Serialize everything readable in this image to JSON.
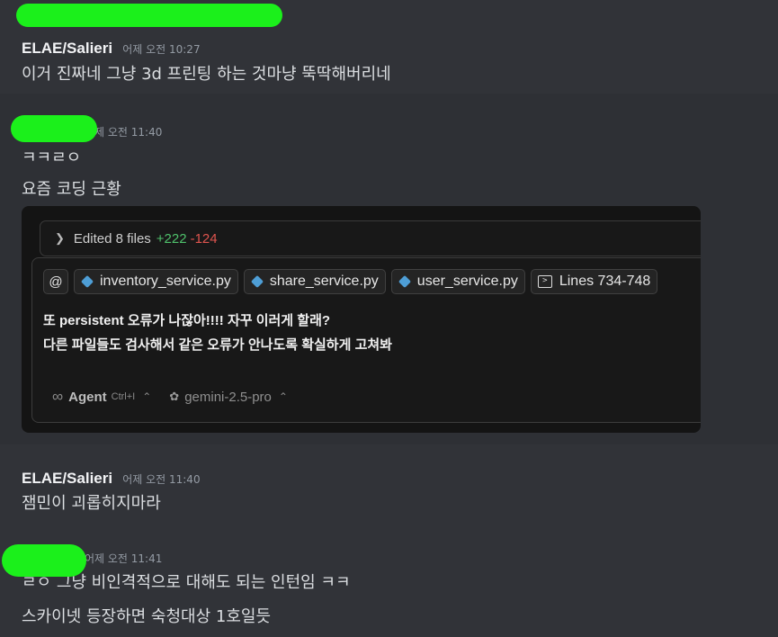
{
  "messages": [
    {
      "author": "ELAE/Salieri",
      "time": "어제 오전 10:27",
      "lines": [
        "이거 진짜네 그냥 3d 프린팅 하는 것마냥 뚝딱해버리네"
      ]
    },
    {
      "author": "",
      "time": "어제 오전 11:40",
      "lines": [
        "ㅋㅋㄹㅇ",
        "요즘 코딩 근황"
      ]
    },
    {
      "author": "ELAE/Salieri",
      "time": "어제 오전 11:40",
      "lines": [
        "잼민이 괴롭히지마라"
      ]
    },
    {
      "author": "",
      "time": "어제 오전 11:41",
      "lines": [
        "ㄹㅇ 그냥 비인격적으로 대해도 되는 인턴임 ㅋㅋ",
        "스카이넷 등장하면 숙청대상 1호일듯"
      ]
    }
  ],
  "embed": {
    "edited_label": "Edited 8 files",
    "added": "+222",
    "removed": "-124",
    "at_symbol": "@",
    "chips": [
      "inventory_service.py",
      "share_service.py",
      "user_service.py"
    ],
    "lines_chip": "Lines 734-748",
    "prompt_line1": "또 persistent 오류가 나잖아!!!! 자꾸 이러게 할래?",
    "prompt_line2": "다른 파일들도 검사해서 같은 오류가 안나도록 확실하게 고쳐봐",
    "agent_symbol": "∞",
    "agent_label": "Agent",
    "agent_shortcut": "Ctrl+I",
    "model": "gemini-2.5-pro"
  },
  "colors": {
    "background": "#313338",
    "redaction": "#1bf01b",
    "diff_added": "#4fc16b",
    "diff_removed": "#e0554f"
  }
}
